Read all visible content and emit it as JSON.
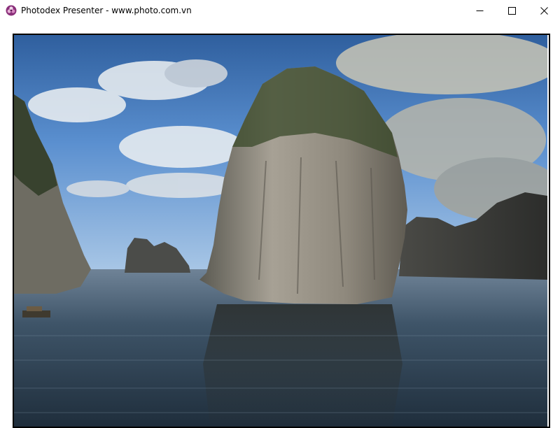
{
  "window": {
    "title": "Photodex Presenter - www.photo.com.vn",
    "app_icon": "photodex-flower-icon",
    "controls": {
      "minimize": "minimize-icon",
      "maximize": "maximize-icon",
      "close": "close-icon"
    }
  },
  "photo": {
    "subject": "limestone-karst-islands-seascape",
    "colors": {
      "sky": "#4f86c6",
      "water": "#3b5061",
      "rock": "#8d877c"
    }
  }
}
